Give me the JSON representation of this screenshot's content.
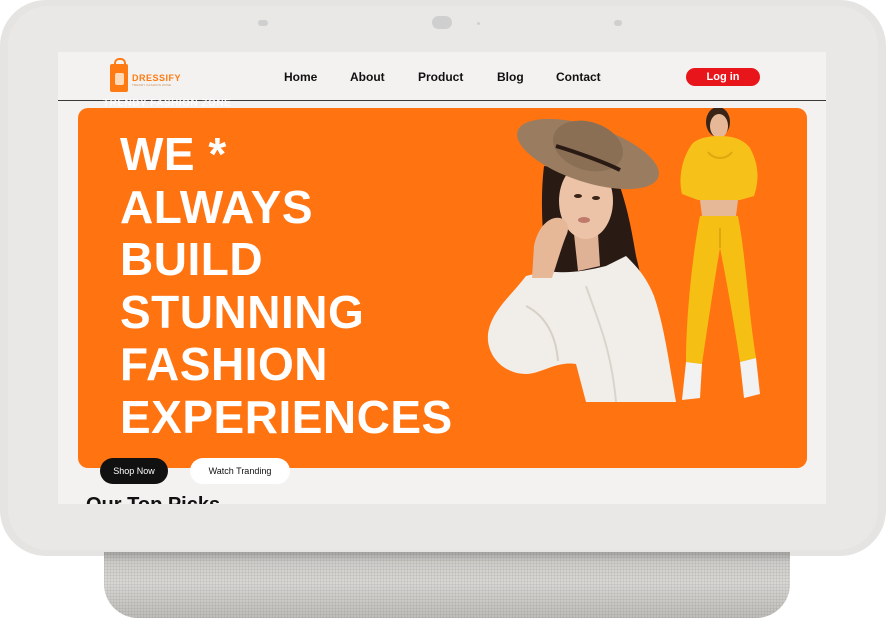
{
  "site": {
    "logo_text": "DRESSIFY",
    "logo_tagline": "TRENDY FASHION ZONE",
    "ghost_text": "TRENDY FASHION ZONE"
  },
  "nav": {
    "links": [
      "Home",
      "About",
      "Product",
      "Blog",
      "Contact"
    ],
    "login_label": "Log in"
  },
  "hero": {
    "headline": [
      "WE *",
      "ALWAYS",
      "BUILD",
      "STUNNING",
      "FASHION",
      "EXPERIENCES"
    ],
    "shop_label": "Shop Now",
    "watch_label": "Watch Tranding"
  },
  "section": {
    "title": "Our Top Picks"
  },
  "colors": {
    "accent": "#ff7310",
    "login": "#e8161b",
    "primary_button": "#111111"
  }
}
